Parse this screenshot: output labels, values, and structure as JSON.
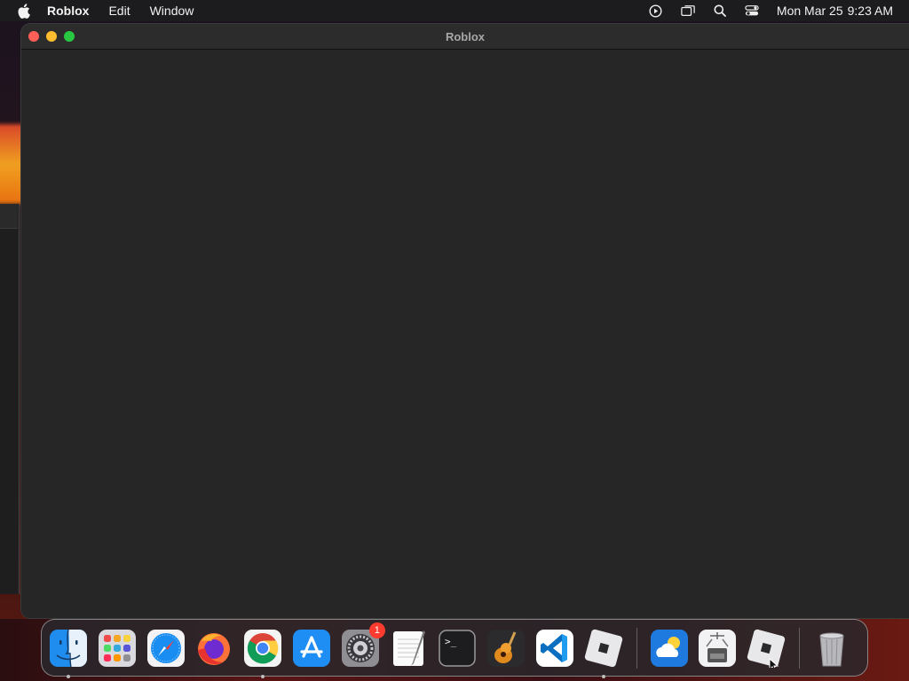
{
  "menubar": {
    "app_name": "Roblox",
    "menus": [
      "Edit",
      "Window"
    ],
    "status_icons": [
      "screen-record-icon",
      "screen-mirroring-icon",
      "spotlight-search-icon",
      "control-center-icon"
    ],
    "date": "Mon Mar 25",
    "time": "9:23 AM"
  },
  "window": {
    "title": "Roblox"
  },
  "dock": {
    "items": [
      {
        "name": "Finder",
        "icon": "finder-icon",
        "running": true
      },
      {
        "name": "Launchpad",
        "icon": "launchpad-icon",
        "running": false
      },
      {
        "name": "Safari",
        "icon": "safari-icon",
        "running": false
      },
      {
        "name": "Firefox",
        "icon": "firefox-icon",
        "running": false
      },
      {
        "name": "Google Chrome",
        "icon": "chrome-icon",
        "running": true
      },
      {
        "name": "App Store",
        "icon": "app-store-icon",
        "running": false
      },
      {
        "name": "System Settings",
        "icon": "system-settings-icon",
        "running": false,
        "badge": "1"
      },
      {
        "name": "TextEdit",
        "icon": "textedit-icon",
        "running": false
      },
      {
        "name": "Terminal",
        "icon": "terminal-icon",
        "running": false
      },
      {
        "name": "GarageBand",
        "icon": "garageband-icon",
        "running": false
      },
      {
        "name": "Visual Studio Code",
        "icon": "vscode-icon",
        "running": false
      },
      {
        "name": "Roblox",
        "icon": "roblox-icon",
        "running": true
      },
      {
        "name": "Weather",
        "icon": "weather-icon",
        "running": false
      },
      {
        "name": "System Information",
        "icon": "system-information-icon",
        "running": false
      },
      {
        "name": "Roblox Studio",
        "icon": "roblox-studio-icon",
        "running": false
      },
      {
        "name": "Trash",
        "icon": "trash-icon",
        "running": false
      }
    ],
    "terminal_prompt": ">_"
  },
  "colors": {
    "close": "#fe5f57",
    "minimize": "#febc2e",
    "maximize": "#28c840",
    "badge": "#ff3b30"
  }
}
